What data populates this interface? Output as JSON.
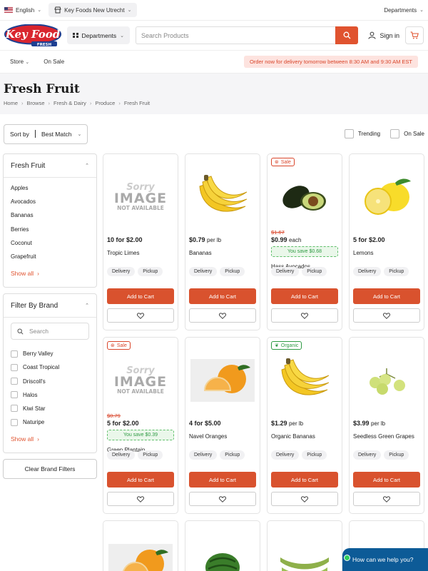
{
  "topbar": {
    "language": "English",
    "store": "Key Foods New Utrecht",
    "departments_label": "Departments"
  },
  "header": {
    "logo_text": "Key Food",
    "logo_sub": "FRESH",
    "departments_button": "Departments",
    "search_placeholder": "Search Products",
    "signin_label": "Sign in"
  },
  "subnav": {
    "store_label": "Store",
    "on_sale_label": "On Sale",
    "delivery_banner": "Order now for delivery tomorrow between 8:30 AM and 9:30 AM EST"
  },
  "page": {
    "title": "Fresh Fruit",
    "breadcrumbs": [
      "Home",
      "Browse",
      "Fresh & Dairy",
      "Produce",
      "Fresh Fruit"
    ]
  },
  "sort": {
    "label": "Sort by",
    "value": "Best Match",
    "trending_label": "Trending",
    "on_sale_label": "On Sale"
  },
  "sidebar": {
    "category_title": "Fresh Fruit",
    "categories": [
      "Apples",
      "Avocados",
      "Bananas",
      "Berries",
      "Coconut",
      "Grapefruit"
    ],
    "show_all": "Show all",
    "brand_title": "Filter By Brand",
    "brand_search_placeholder": "Search",
    "brands": [
      "Berry Valley",
      "Coast Tropical",
      "Driscoll's",
      "Halos",
      "Kiwi Star",
      "Naturipe"
    ],
    "brand_show_all": "Show all",
    "clear_filters": "Clear Brand Filters"
  },
  "product_labels": {
    "delivery": "Delivery",
    "pickup": "Pickup",
    "add_to_cart": "Add to Cart",
    "sale_badge": "Sale",
    "organic_badge": "Organic",
    "sorry_line1": "Sorry",
    "sorry_line2": "IMAGE",
    "sorry_line3": "NOT AVAILABLE"
  },
  "products": [
    {
      "name": "Tropic Limes",
      "price": "10 for $2.00",
      "unit": "",
      "old_price": "",
      "savings": "",
      "badge": "",
      "image": "no-image"
    },
    {
      "name": "Bananas",
      "price": "$0.79",
      "unit": "per lb",
      "old_price": "",
      "savings": "",
      "badge": "",
      "image": "bananas-image"
    },
    {
      "name": "Hass Avocados",
      "price": "$0.99",
      "unit": "each",
      "old_price": "$1.67",
      "savings": "You save $0.68",
      "badge": "sale",
      "image": "avocado-image"
    },
    {
      "name": "Lemons",
      "price": "5 for $2.00",
      "unit": "",
      "old_price": "",
      "savings": "",
      "badge": "",
      "image": "lemon-image"
    },
    {
      "name": "Green Plantain",
      "price": "5 for $2.00",
      "unit": "",
      "old_price": "$0.79",
      "savings": "You save $0.39",
      "badge": "sale",
      "image": "no-image"
    },
    {
      "name": "Navel Oranges",
      "price": "4 for $5.00",
      "unit": "",
      "old_price": "",
      "savings": "",
      "badge": "",
      "image": "orange-image"
    },
    {
      "name": "Organic Bananas",
      "price": "$1.29",
      "unit": "per lb",
      "old_price": "",
      "savings": "",
      "badge": "organic",
      "image": "bananas-image"
    },
    {
      "name": "Seedless Green Grapes",
      "price": "$3.99",
      "unit": "per lb",
      "old_price": "",
      "savings": "",
      "badge": "",
      "image": "grapes-image"
    }
  ],
  "chat": {
    "label": "How can we help you?"
  },
  "colors": {
    "accent": "#e0532f",
    "sale_red": "#d9452a",
    "savings_green": "#2e9a43",
    "chat_blue": "#0d5b97"
  }
}
